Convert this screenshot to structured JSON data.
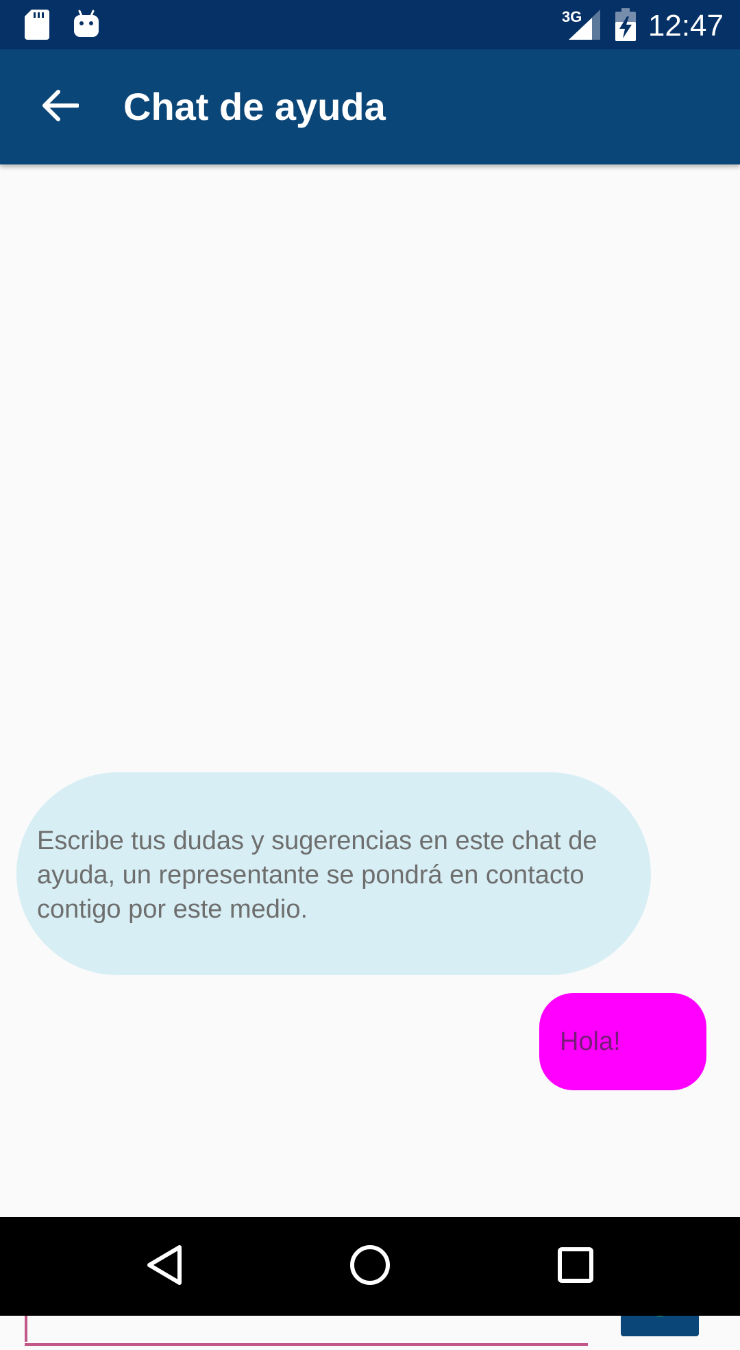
{
  "status_bar": {
    "time": "12:47",
    "network": "3G",
    "icons": [
      "sd-card-icon",
      "android-debug-icon",
      "signal-icon",
      "battery-charging-icon"
    ]
  },
  "app_bar": {
    "title": "Chat de ayuda",
    "back_icon": "arrow-back-icon"
  },
  "chat": {
    "messages": [
      {
        "from": "system",
        "text": "Escribe tus dudas y sugerencias en este chat de ayuda, un representante se pondrá en contacto contigo por este medio."
      },
      {
        "from": "user",
        "text": "Hola!"
      }
    ]
  },
  "composer": {
    "input_value": "",
    "send_icon": "check-circle-icon"
  },
  "nav_bar": {
    "icons": [
      "nav-back-icon",
      "nav-home-icon",
      "nav-recents-icon"
    ]
  },
  "colors": {
    "status_bar": "#063166",
    "app_bar": "#0b4678",
    "system_bubble": "#d7eef4",
    "user_bubble": "#ff00ff",
    "input_accent": "#c2588a",
    "send_check": "#1fae6b"
  }
}
